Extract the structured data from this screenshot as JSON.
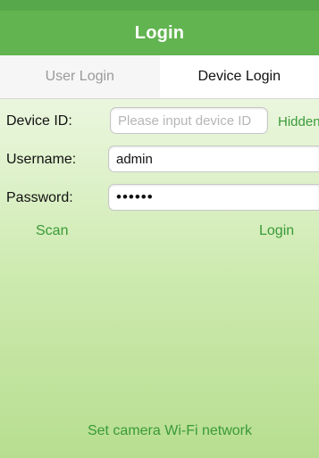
{
  "nav": {
    "title": "Login"
  },
  "tabs": [
    {
      "label": "User Login",
      "active": false
    },
    {
      "label": "Device Login",
      "active": true
    }
  ],
  "form": {
    "device_id": {
      "label": "Device ID:",
      "value": "",
      "placeholder": "Please input device ID",
      "hidden_label": "Hidden"
    },
    "username": {
      "label": "Username:",
      "value": "admin",
      "placeholder": ""
    },
    "password": {
      "label": "Password:",
      "value": "123456",
      "placeholder": ""
    }
  },
  "actions": {
    "scan_label": "Scan",
    "login_label": "Login"
  },
  "footer": {
    "wifi_label": "Set camera Wi-Fi network"
  },
  "colors": {
    "nav_background": "#62b450",
    "accent_link": "#3a9a37",
    "gradient_top": "#f7fbf2",
    "gradient_bottom": "#b7de90"
  }
}
